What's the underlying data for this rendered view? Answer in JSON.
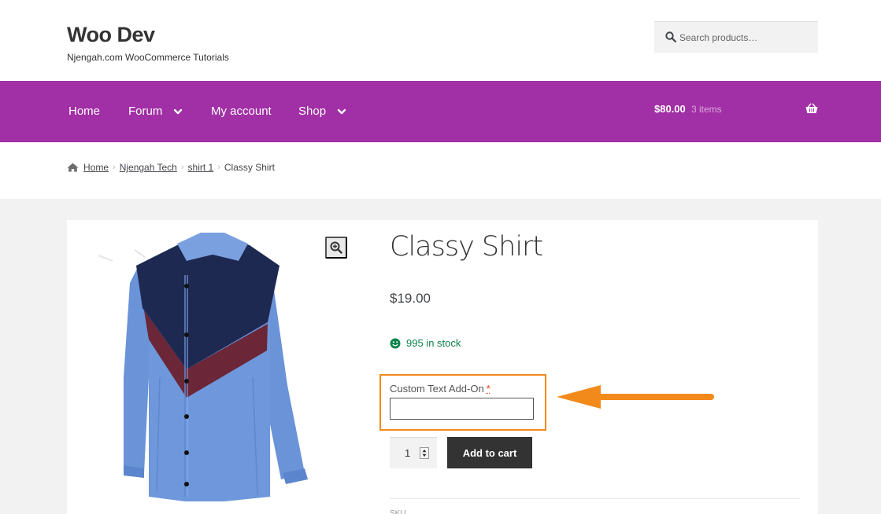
{
  "header": {
    "site_title": "Woo Dev",
    "site_description": "Njengah.com WooCommerce Tutorials",
    "search_placeholder": "Search products…"
  },
  "nav": {
    "items": [
      {
        "label": "Home",
        "has_dropdown": false
      },
      {
        "label": "Forum",
        "has_dropdown": true
      },
      {
        "label": "My account",
        "has_dropdown": false
      },
      {
        "label": "Shop",
        "has_dropdown": true
      }
    ],
    "cart_amount": "$80.00",
    "cart_count": "3 items"
  },
  "breadcrumb": {
    "items": [
      "Home",
      "Njengah Tech",
      "shirt 1"
    ],
    "current": "Classy Shirt"
  },
  "product": {
    "title": "Classy Shirt",
    "price": "$19.00",
    "stock": "995 in stock",
    "addon_label": "Custom Text Add-On",
    "addon_required_mark": "*",
    "addon_value": "",
    "quantity": "1",
    "add_to_cart_label": "Add to cart",
    "sku_label": "SKU"
  },
  "colors": {
    "nav_background": "#a12fa5",
    "highlight": "#f28a1b",
    "stock": "#0f834d",
    "button": "#333333"
  },
  "icons": {
    "search": "search-icon",
    "cart": "basket-icon",
    "home": "home-icon",
    "zoom": "zoom-in-icon",
    "stock": "smile-icon",
    "dropdown": "chevron-down-icon"
  }
}
